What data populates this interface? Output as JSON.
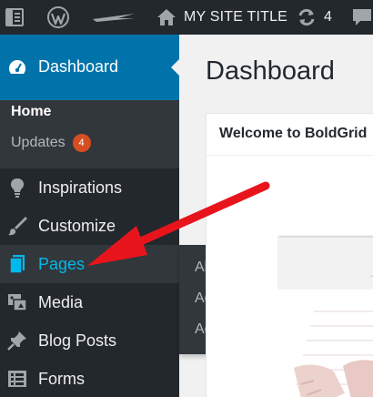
{
  "admin_bar": {
    "site_title": "MY SITE TITLE",
    "updates_count": "4",
    "icons": [
      "collapse-menu-icon",
      "wordpress-logo-icon",
      "boldgrid-brand-icon",
      "home-icon",
      "refresh-icon",
      "comment-icon"
    ]
  },
  "menu": {
    "dashboard": {
      "label": "Dashboard",
      "icon": "dashboard-icon"
    },
    "dashboard_submenu": {
      "home": "Home",
      "updates": "Updates",
      "updates_badge": "4"
    },
    "items": [
      {
        "label": "Inspirations",
        "icon": "lightbulb-icon"
      },
      {
        "label": "Customize",
        "icon": "paintbrush-icon"
      },
      {
        "label": "Pages",
        "icon": "pages-icon"
      },
      {
        "label": "Media",
        "icon": "media-icon"
      },
      {
        "label": "Blog Posts",
        "icon": "pin-icon"
      },
      {
        "label": "Forms",
        "icon": "forms-icon"
      }
    ]
  },
  "pages_flyout": {
    "items": [
      "All Pages",
      "Add New",
      "Add Blank"
    ]
  },
  "main": {
    "page_title": "Dashboard",
    "welcome_panel_title": "Welcome to BoldGrid"
  },
  "colors": {
    "admin_bar_bg": "#23282d",
    "menu_active_bg": "#0073aa",
    "submenu_bg": "#32373c",
    "current_text": "#00b9eb",
    "badge": "#d54e21",
    "annotation_arrow": "#e8141c"
  }
}
